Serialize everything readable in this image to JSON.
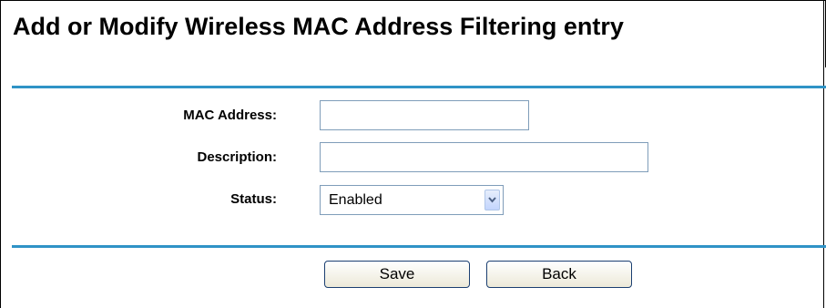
{
  "page": {
    "title": "Add or Modify Wireless MAC Address Filtering entry"
  },
  "form": {
    "mac_address": {
      "label": "MAC Address:",
      "value": ""
    },
    "description": {
      "label": "Description:",
      "value": ""
    },
    "status": {
      "label": "Status:",
      "value": "Enabled"
    }
  },
  "buttons": {
    "save_label": "Save",
    "back_label": "Back"
  },
  "colors": {
    "rule": "#2f93c6",
    "input_border": "#7f9db9"
  }
}
